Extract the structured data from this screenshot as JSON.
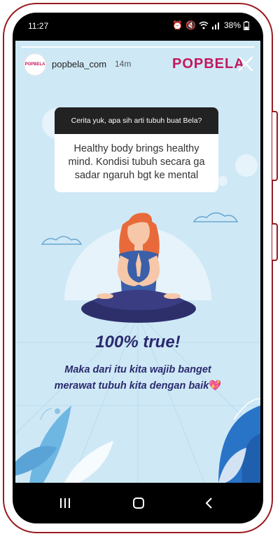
{
  "status_bar": {
    "time": "11:27",
    "battery": "38%"
  },
  "story": {
    "username": "popbela_com",
    "time_ago": "14m",
    "brand_logo": "POPBELA",
    "avatar_text": "POPBELA",
    "question": "Cerita yuk, apa sih arti tubuh buat Bela?",
    "answer": "Healthy body brings healthy mind. Kondisi tubuh secara ga sadar ngaruh bgt ke mental",
    "headline": "100% true!",
    "body_line1": "Maka dari itu kita wajib banget",
    "body_line2": "merawat tubuh kita dengan baik",
    "emoji": "💖"
  },
  "nav_bar": {
    "recent_icon": "recent-apps-icon",
    "home_icon": "home-icon",
    "back_icon": "back-icon"
  },
  "colors": {
    "frame": "#9a1c22",
    "story_bg": "#cfe8f6",
    "brand": "#c2185b",
    "text_dark": "#2a2a6e"
  }
}
